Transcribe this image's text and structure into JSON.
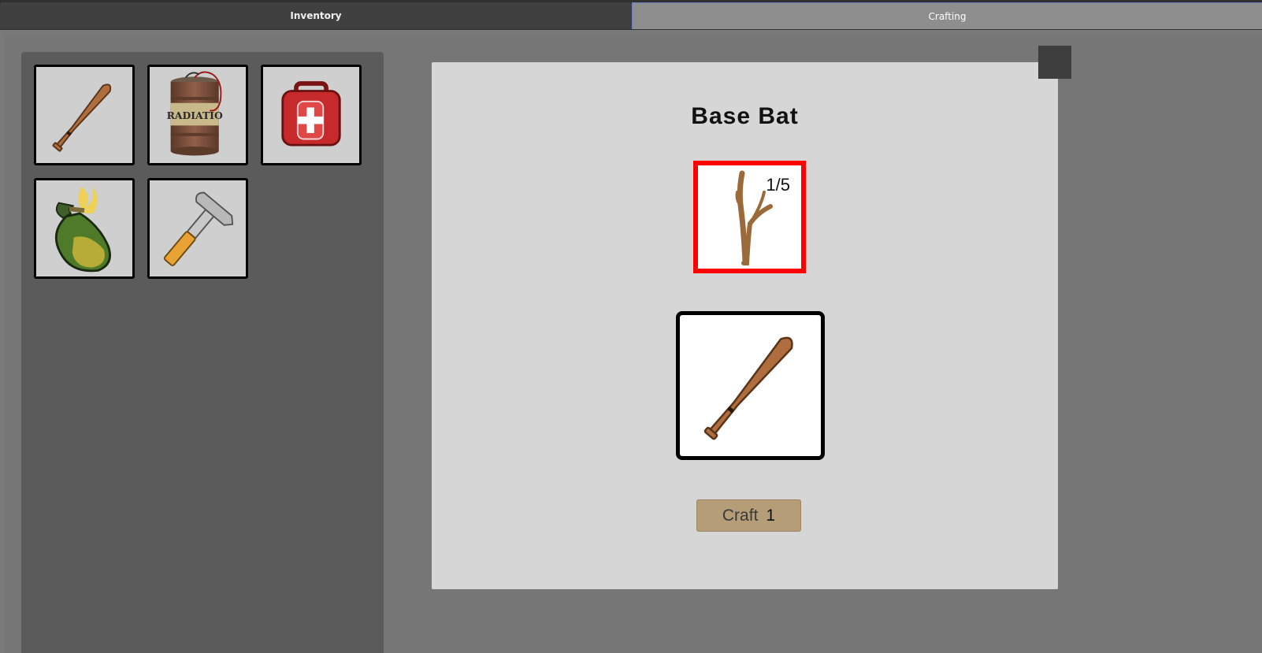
{
  "tabs": [
    {
      "label": "Inventory",
      "active": false
    },
    {
      "label": "Crafting",
      "active": true
    }
  ],
  "inventory": {
    "items": [
      {
        "icon": "baseball-bat-icon"
      },
      {
        "icon": "radiation-barrel-icon",
        "text": "RADIATIO"
      },
      {
        "icon": "first-aid-kit-icon"
      },
      {
        "icon": "molotov-bottle-icon"
      },
      {
        "icon": "hammer-icon"
      }
    ]
  },
  "recipe": {
    "title": "Base Bat",
    "ingredient": {
      "icon": "stick-icon",
      "count": "1/5",
      "border_color": "#ff0000"
    },
    "result": {
      "icon": "baseball-bat-icon"
    },
    "craft_label": "Craft",
    "craft_quantity": "1"
  },
  "colors": {
    "panel_bg": "#d6d6d6",
    "inventory_bg": "#5b5b5b",
    "craft_button": "#b49d77",
    "missing_ingredient": "#ff0000"
  }
}
